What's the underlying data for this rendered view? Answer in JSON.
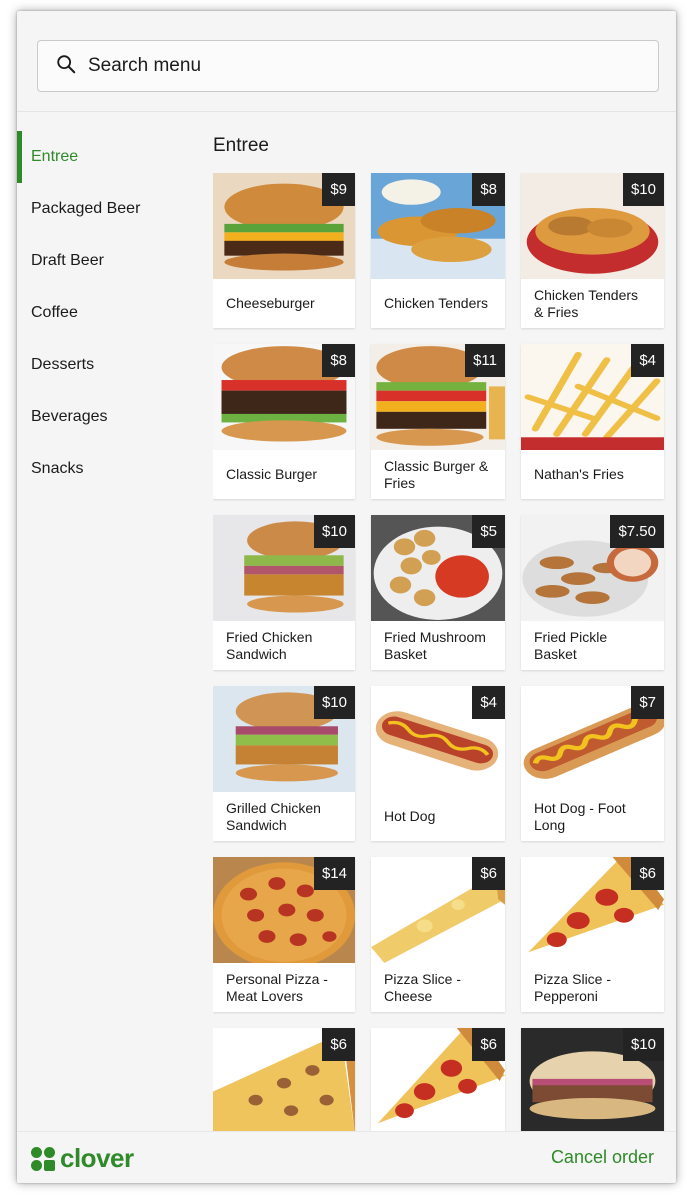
{
  "search": {
    "placeholder": "Search menu"
  },
  "sidebar": {
    "items": [
      {
        "label": "Entree",
        "active": true
      },
      {
        "label": "Packaged Beer"
      },
      {
        "label": "Draft Beer"
      },
      {
        "label": "Coffee"
      },
      {
        "label": "Desserts"
      },
      {
        "label": "Beverages"
      },
      {
        "label": "Snacks"
      }
    ]
  },
  "section": {
    "title": "Entree"
  },
  "items": [
    {
      "name": "Cheeseburger",
      "price": "$9",
      "icon": "cheeseburger-image"
    },
    {
      "name": "Chicken Tenders",
      "price": "$8",
      "icon": "chicken-tenders-image"
    },
    {
      "name": "Chicken Tenders & Fries",
      "price": "$10",
      "icon": "tenders-fries-image"
    },
    {
      "name": "Classic Burger",
      "price": "$8",
      "icon": "burger-image"
    },
    {
      "name": "Classic Burger & Fries",
      "price": "$11",
      "icon": "burger-fries-image"
    },
    {
      "name": "Nathan's Fries",
      "price": "$4",
      "icon": "fries-image"
    },
    {
      "name": "Fried Chicken Sandwich",
      "price": "$10",
      "icon": "chicken-sandwich-image"
    },
    {
      "name": "Fried Mushroom Basket",
      "price": "$5",
      "icon": "mushroom-basket-image"
    },
    {
      "name": "Fried Pickle Basket",
      "price": "$7.50",
      "icon": "pickle-basket-image"
    },
    {
      "name": "Grilled Chicken Sandwich",
      "price": "$10",
      "icon": "grilled-chicken-image"
    },
    {
      "name": "Hot Dog",
      "price": "$4",
      "icon": "hot-dog-image"
    },
    {
      "name": "Hot Dog - Foot Long",
      "price": "$7",
      "icon": "foot-long-image"
    },
    {
      "name": "Personal Pizza - Meat Lovers",
      "price": "$14",
      "icon": "pizza-image"
    },
    {
      "name": "Pizza Slice - Cheese",
      "price": "$6",
      "icon": "cheese-slice-image"
    },
    {
      "name": "Pizza Slice - Pepperoni",
      "price": "$6",
      "icon": "pepperoni-slice-image"
    },
    {
      "name": "",
      "price": "$6",
      "icon": "sausage-slice-image"
    },
    {
      "name": "",
      "price": "$6",
      "icon": "pepperoni-slice-image"
    },
    {
      "name": "",
      "price": "$10",
      "icon": "steak-sandwich-image"
    }
  ],
  "footer": {
    "logo_text": "clover",
    "cancel_label": "Cancel order"
  },
  "colors": {
    "accent": "#2f8a29",
    "price_badge": "#232323",
    "panel": "#f4f5f4"
  }
}
